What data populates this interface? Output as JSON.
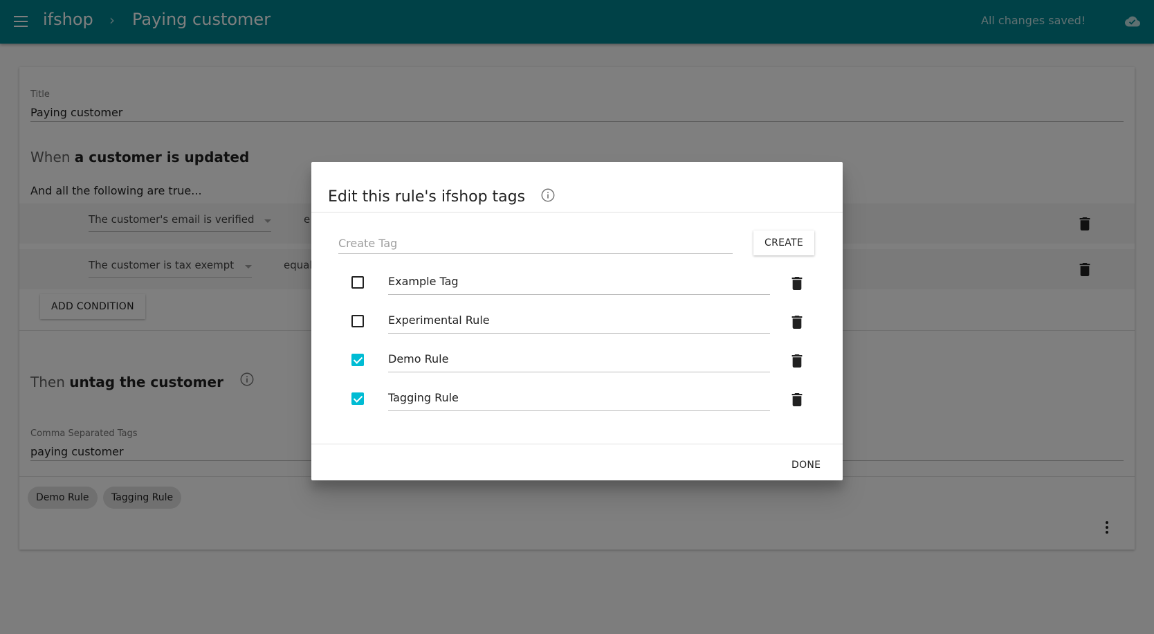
{
  "header": {
    "app_name": "ifshop",
    "breadcrumb_separator": "›",
    "page_name": "Paying customer",
    "save_status": "All changes saved!",
    "icons": [
      "menu-icon",
      "cloud-done-icon"
    ]
  },
  "rule": {
    "title_label": "Title",
    "title_value": "Paying customer",
    "trigger_prefix": "When",
    "trigger_text": "a customer is updated",
    "conditions_intro": "And all the following are true...",
    "conditions": [
      {
        "subject": "The customer's email is verified",
        "operator": "e"
      },
      {
        "subject": "The customer is tax exempt",
        "operator": "equal"
      }
    ],
    "add_condition_label": "ADD CONDITION",
    "action_prefix": "Then",
    "action_text": "untag the customer",
    "tags_field_label": "Comma Separated Tags",
    "tags_field_value": "paying customer",
    "rule_tags": [
      "Demo Rule",
      "Tagging Rule"
    ]
  },
  "dialog": {
    "title": "Edit this rule's ifshop tags",
    "create_placeholder": "Create Tag",
    "create_label": "CREATE",
    "tags": [
      {
        "name": "Example Tag",
        "checked": false
      },
      {
        "name": "Experimental Rule",
        "checked": false
      },
      {
        "name": "Demo Rule",
        "checked": true
      },
      {
        "name": "Tagging Rule",
        "checked": true
      }
    ],
    "done_label": "DONE"
  },
  "colors": {
    "appbar": "#00838f",
    "checkbox_checked": "#00bcd4"
  }
}
